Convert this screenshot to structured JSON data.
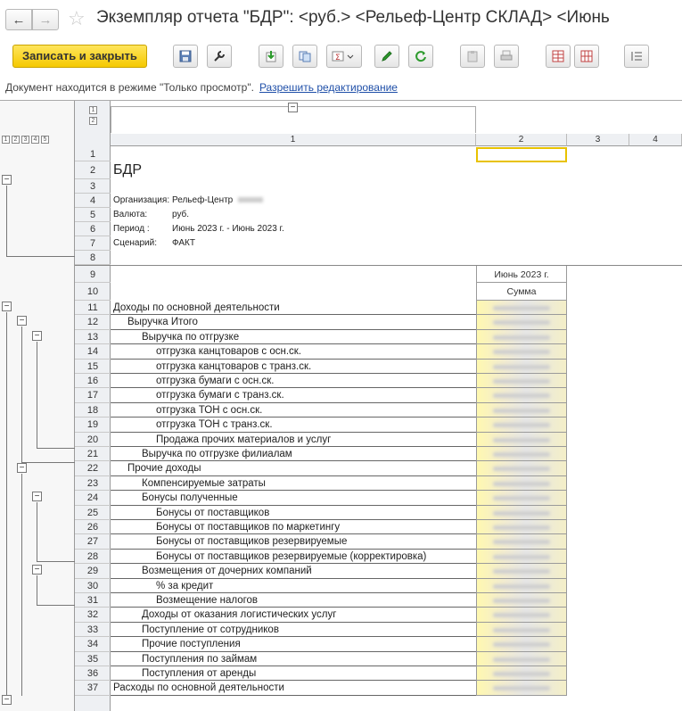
{
  "window": {
    "title": "Экземпляр отчета \"БДР\": <руб.> <Рельеф-Центр СКЛАД> <Июнь",
    "back_arrow": "←",
    "forward_arrow": "→",
    "star": "☆"
  },
  "toolbar": {
    "save_close_label": "Записать и закрыть",
    "buttons": [
      "save-icon",
      "wrench-icon",
      "export-icon",
      "copy-icon",
      "sum-dropdown-icon",
      "pencil-icon",
      "refresh-icon",
      "clipboard-icon",
      "print-icon",
      "grid-split-icon",
      "grid-merge-icon",
      "indent-icon"
    ]
  },
  "notice": {
    "text": "Документ находится в режиме \"Только просмотр\".",
    "link": "Разрешить редактирование"
  },
  "sheet": {
    "level_labels": [
      "1",
      "2",
      "3",
      "4",
      "5"
    ],
    "group_levels": [
      "1",
      "2"
    ],
    "column_headers": [
      "1",
      "2",
      "3",
      "4"
    ],
    "collapse_symbol": "−",
    "report_title": "БДР",
    "meta": [
      {
        "label": "Организация:",
        "value": "Рельеф-Центр"
      },
      {
        "label": "Валюта:",
        "value": "руб."
      },
      {
        "label": "Период :",
        "value": "Июнь 2023 г. - Июнь 2023 г."
      },
      {
        "label": "Сценарий:",
        "value": "ФАКТ"
      }
    ],
    "period_header": "Июнь 2023 г.",
    "amount_header": "Сумма",
    "rows": [
      {
        "n": "11",
        "label": "Доходы по основной деятельности",
        "indent": 0
      },
      {
        "n": "12",
        "label": "Выручка Итого",
        "indent": 1
      },
      {
        "n": "13",
        "label": "Выручка по отгрузке",
        "indent": 2
      },
      {
        "n": "14",
        "label": "отгрузка канцтоваров с осн.ск.",
        "indent": 3
      },
      {
        "n": "15",
        "label": "отгрузка канцтоваров с транз.ск.",
        "indent": 3
      },
      {
        "n": "16",
        "label": "отгрузка бумаги с осн.ск.",
        "indent": 3
      },
      {
        "n": "17",
        "label": "отгрузка бумаги с транз.ск.",
        "indent": 3
      },
      {
        "n": "18",
        "label": "отгрузка ТОН с осн.ск.",
        "indent": 3
      },
      {
        "n": "19",
        "label": "отгрузка ТОН с транз.ск.",
        "indent": 3
      },
      {
        "n": "20",
        "label": "Продажа прочих материалов и услуг",
        "indent": 3
      },
      {
        "n": "21",
        "label": "Выручка по отгрузке филиалам",
        "indent": 2
      },
      {
        "n": "22",
        "label": "Прочие доходы",
        "indent": 1
      },
      {
        "n": "23",
        "label": "Компенсируемые затраты",
        "indent": 2
      },
      {
        "n": "24",
        "label": "Бонусы полученные",
        "indent": 2
      },
      {
        "n": "25",
        "label": "Бонусы от поставщиков",
        "indent": 3
      },
      {
        "n": "26",
        "label": "Бонусы от поставщиков по маркетингу",
        "indent": 3
      },
      {
        "n": "27",
        "label": "Бонусы от поставщиков резервируемые",
        "indent": 3
      },
      {
        "n": "28",
        "label": "Бонусы от поставщиков резервируемые (корректировка)",
        "indent": 3
      },
      {
        "n": "29",
        "label": "Возмещения от дочерних компаний",
        "indent": 2
      },
      {
        "n": "30",
        "label": "% за кредит",
        "indent": 3
      },
      {
        "n": "31",
        "label": "Возмещение налогов",
        "indent": 3
      },
      {
        "n": "32",
        "label": "Доходы от оказания логистических услуг",
        "indent": 2
      },
      {
        "n": "33",
        "label": "Поступление от сотрудников",
        "indent": 2
      },
      {
        "n": "34",
        "label": "Прочие поступления",
        "indent": 2
      },
      {
        "n": "35",
        "label": "Поступления по займам",
        "indent": 2
      },
      {
        "n": "36",
        "label": "Поступления от аренды",
        "indent": 2
      },
      {
        "n": "37",
        "label": "Расходы по основной деятельности",
        "indent": 0
      }
    ],
    "header_rows": [
      "1",
      "2",
      "3",
      "4",
      "5",
      "6",
      "7",
      "8",
      "9",
      "10"
    ]
  }
}
